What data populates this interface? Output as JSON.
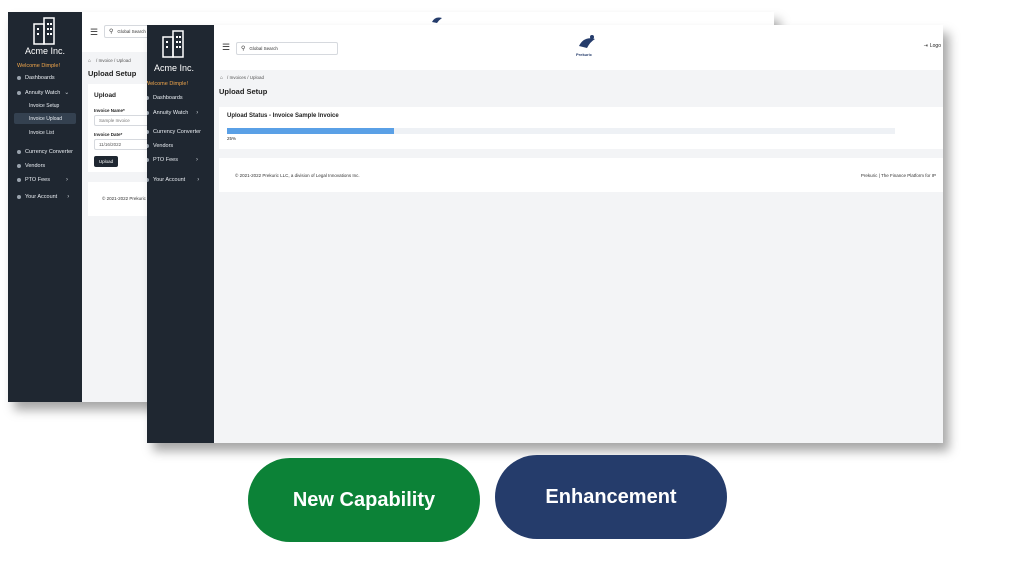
{
  "brand": "Acme Inc.",
  "welcome": "Welcome Dimple!",
  "search": {
    "placeholder": "Global Search"
  },
  "back_window": {
    "nav": {
      "dashboards": "Dashboards",
      "annuity_watch": "Annuity Watch",
      "invoice_setup": "Invoice Setup",
      "invoice_upload": "Invoice Upload",
      "invoice_list": "Invoice List",
      "currency_converter": "Currency Converter",
      "vendors": "Vendors",
      "pto_fees": "PTO Fees",
      "your_account": "Your Account"
    },
    "breadcrumb": "/ Invoice / Upload",
    "page_title": "Upload Setup",
    "form": {
      "heading": "Upload",
      "name_label": "Invoice Name*",
      "name_placeholder": "Sample Invoice",
      "date_label": "Invoice Date*",
      "date_value": "11/16/2022",
      "upload_button": "Upload"
    },
    "footer": "© 2021-2022 Prekuric"
  },
  "front_window": {
    "nav": {
      "dashboards": "Dashboards",
      "annuity_watch": "Annuity Watch",
      "currency_converter": "Currency Converter",
      "vendors": "Vendors",
      "pto_fees": "PTO Fees",
      "your_account": "Your Account"
    },
    "breadcrumb": "/ Invoices / Upload",
    "page_title": "Upload Setup",
    "upload_status_title": "Upload Status - Invoice Sample Invoice",
    "progress": {
      "percent": 25,
      "label": "25%"
    },
    "footer_left": "© 2021-2022 Prekuric LLC, a division of Legal Innovations Inc.",
    "footer_right": "Prekuric | The Finance Platform for IP",
    "logo_text": "Prekuric",
    "logout": "Logo"
  },
  "badges": {
    "new_capability": "New Capability",
    "enhancement": "Enhancement"
  },
  "colors": {
    "sidebar": "#1f2731",
    "accent_orange": "#f0a64b",
    "progress": "#5aa0e6",
    "green": "#0c8237",
    "navy": "#253c6b"
  }
}
